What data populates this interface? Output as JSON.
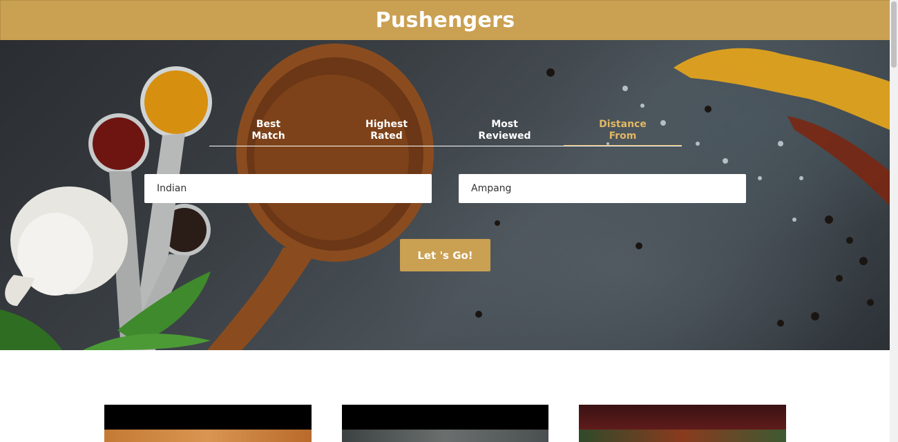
{
  "header": {
    "title": "Pushengers"
  },
  "search": {
    "tabs": [
      {
        "line1": "Best",
        "line2": "Match"
      },
      {
        "line1": "Highest",
        "line2": "Rated"
      },
      {
        "line1": "Most",
        "line2": "Reviewed"
      },
      {
        "line1": "Distance",
        "line2": "From"
      }
    ],
    "active_tab": "Distance From",
    "cuisine_value": "Indian",
    "location_value": "Ampang",
    "submit_label": "Let 's Go!"
  },
  "colors": {
    "brand": "#caa052",
    "active_tab": "#e2b863"
  },
  "cards": [
    {
      "name": "restaurant-card-1"
    },
    {
      "name": "restaurant-card-2"
    },
    {
      "name": "restaurant-card-3"
    }
  ]
}
